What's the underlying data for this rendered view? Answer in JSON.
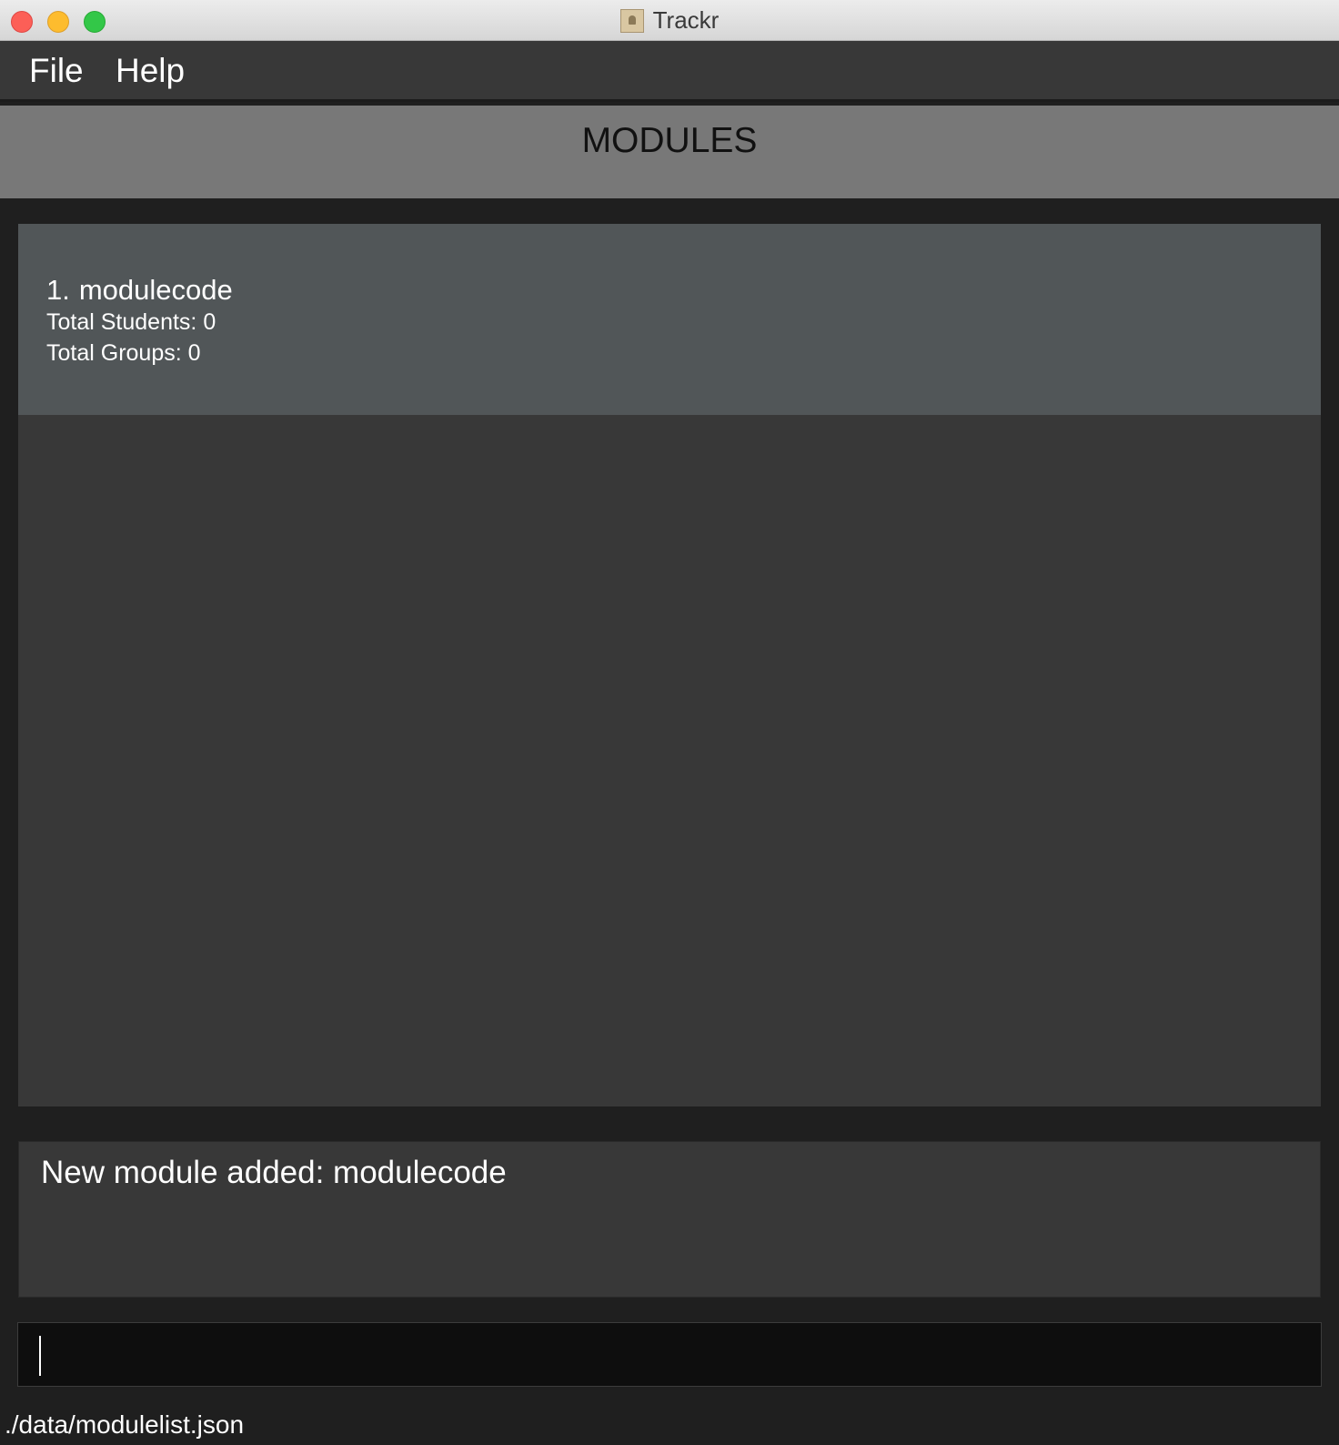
{
  "window": {
    "title": "Trackr",
    "app_icon": "app-document-icon"
  },
  "menu": {
    "items": [
      {
        "label": "File"
      },
      {
        "label": "Help"
      }
    ]
  },
  "header": {
    "title": "MODULES"
  },
  "modules": [
    {
      "index": "1.",
      "code": "modulecode",
      "students": "Total Students: 0",
      "groups": "Total Groups: 0"
    }
  ],
  "result": {
    "message": "New module added: modulecode"
  },
  "command": {
    "value": "",
    "placeholder": ""
  },
  "status": {
    "save_path": "./data/modulelist.json"
  },
  "colors": {
    "menu_bg": "#383838",
    "header_bg": "#787878",
    "card_bg": "#515658",
    "panel_bg": "#383838",
    "input_bg": "#0e0e0e"
  }
}
